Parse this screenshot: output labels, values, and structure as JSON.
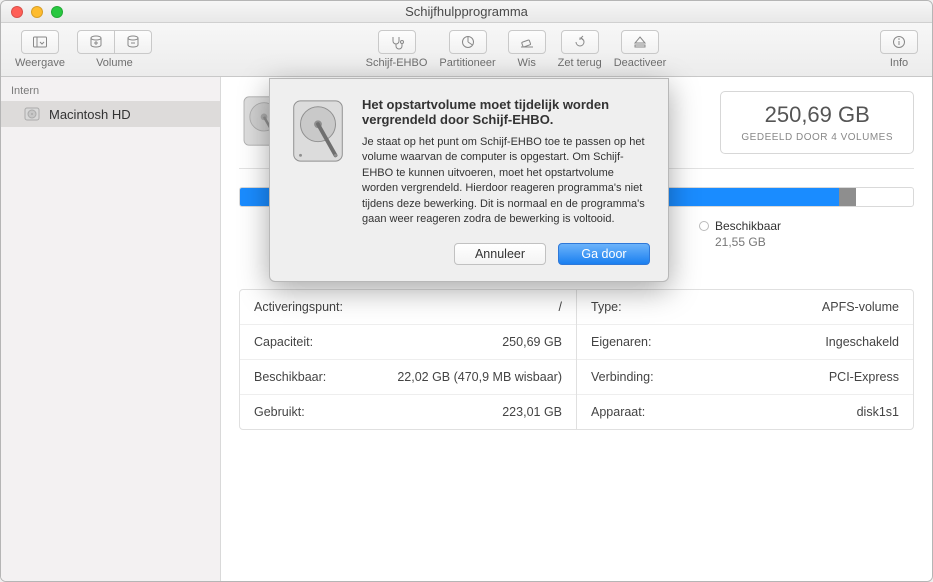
{
  "window": {
    "title": "Schijfhulpprogramma"
  },
  "toolbar": {
    "view": "Weergave",
    "volume": "Volume",
    "firstaid": "Schijf-EHBO",
    "partition": "Partitioneer",
    "erase": "Wis",
    "restore": "Zet terug",
    "unmount": "Deactiveer",
    "info": "Info"
  },
  "sidebar": {
    "header": "Intern",
    "items": [
      {
        "label": "Macintosh HD"
      }
    ]
  },
  "capacity": {
    "value": "250,69 GB",
    "subtitle": "GEDEELD DOOR 4 VOLUMES"
  },
  "legend": {
    "free_label": "Beschikbaar",
    "free_value": "21,55 GB"
  },
  "info": {
    "left": [
      {
        "k": "Activeringspunt:",
        "v": "/"
      },
      {
        "k": "Capaciteit:",
        "v": "250,69 GB"
      },
      {
        "k": "Beschikbaar:",
        "v": "22,02 GB (470,9 MB wisbaar)"
      },
      {
        "k": "Gebruikt:",
        "v": "223,01 GB"
      }
    ],
    "right": [
      {
        "k": "Type:",
        "v": "APFS-volume"
      },
      {
        "k": "Eigenaren:",
        "v": "Ingeschakeld"
      },
      {
        "k": "Verbinding:",
        "v": "PCI-Express"
      },
      {
        "k": "Apparaat:",
        "v": "disk1s1"
      }
    ]
  },
  "dialog": {
    "heading": "Het opstartvolume moet tijdelijk worden vergrendeld door Schijf-EHBO.",
    "body": "Je staat op het punt om Schijf-EHBO toe te passen op het volume waarvan de computer is opgestart. Om Schijf-EHBO te kunnen uitvoeren, moet het opstartvolume worden vergrendeld. Hierdoor reageren programma's niet tijdens deze bewerking. Dit is normaal en de programma's gaan weer reageren zodra de bewerking is voltooid.",
    "cancel": "Annuleer",
    "continue": "Ga door"
  }
}
